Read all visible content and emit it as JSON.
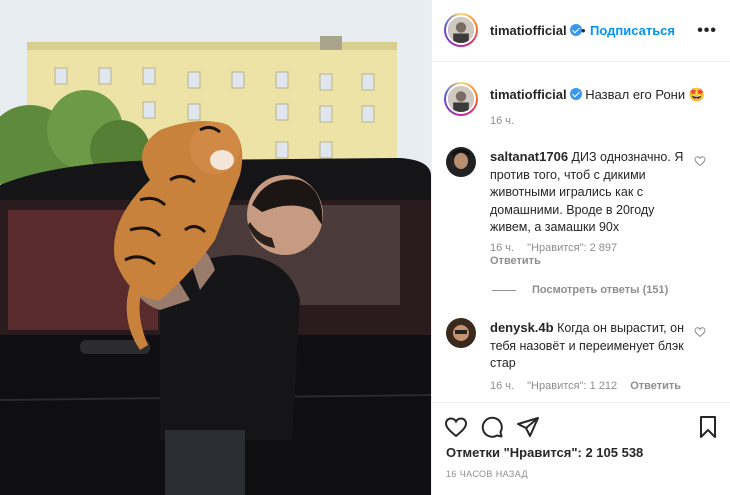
{
  "colors": {
    "accent": "#0095f6",
    "verified": "#3897f0",
    "muted": "#8e8e8e",
    "border": "#efefef"
  },
  "header": {
    "username": "timatiofficial",
    "dot": "•",
    "follow_label": "Подписаться",
    "more_icon": "more-horizontal-icon"
  },
  "caption": {
    "username": "timatiofficial",
    "text": "Назвал его Рони",
    "emoji": "🤩",
    "time": "16 ч."
  },
  "comments": [
    {
      "username": "saltanat1706",
      "text": "ДИЗ однозначно. Я против того, чтоб с дикими животными игрались как с домашними. Вроде в 20году живем, а замашки 90х",
      "time": "16 ч.",
      "likes": "\"Нравится\": 2 897",
      "reply": "Ответить"
    },
    {
      "username": "denysk.4b",
      "text": "Когда он вырастит, он тебя назовёт и переименует блэк стар",
      "time": "16 ч.",
      "likes": "\"Нравится\": 1 212",
      "reply": "Ответить"
    }
  ],
  "view_replies": "Посмотреть ответы (151)",
  "actions": {
    "icons": [
      "heart-icon",
      "comment-icon",
      "share-icon",
      "bookmark-icon"
    ],
    "likes": "Отметки \"Нравится\": 2 105 538",
    "time": "16 ЧАСОВ НАЗАД"
  }
}
